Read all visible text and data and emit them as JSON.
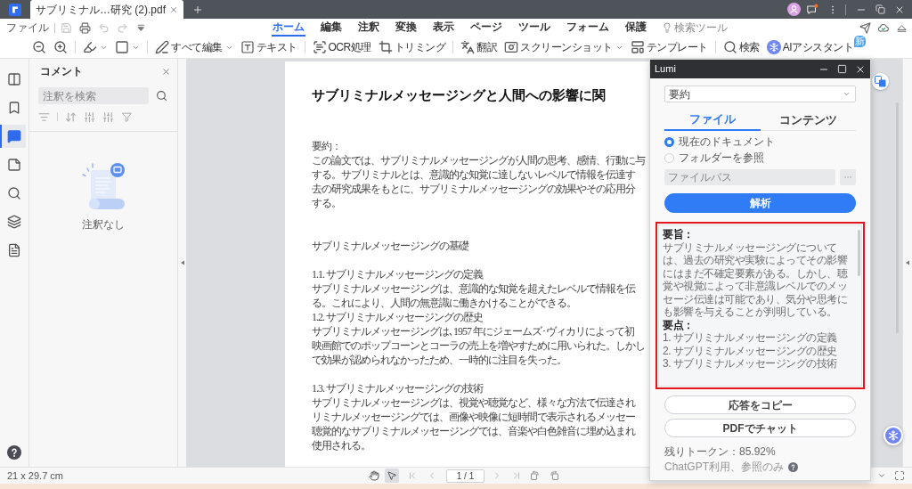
{
  "title_bar": {
    "document_tab": {
      "title": "サブリミナル…研究 (2).pdf"
    }
  },
  "menu_bar": {
    "file_menu": "ファイル",
    "quick_actions": [
      {
        "disabled": true
      },
      {
        "disabled": false
      },
      {
        "disabled": true
      },
      {
        "disabled": true
      }
    ],
    "tabs": [
      {
        "label": "ホーム",
        "selected": true
      },
      {
        "label": "編集",
        "selected": false
      },
      {
        "label": "注釈",
        "selected": false
      },
      {
        "label": "変換",
        "selected": false
      },
      {
        "label": "表示",
        "selected": false
      },
      {
        "label": "ページ",
        "selected": false
      },
      {
        "label": "ツール",
        "selected": false
      },
      {
        "label": "フォーム",
        "selected": false
      },
      {
        "label": "保護",
        "selected": false
      }
    ],
    "search_tools": {
      "label": "検索ツール",
      "disabled": true
    }
  },
  "toolbar": {
    "groups": [
      [
        {
          "dropdown": false
        },
        {
          "dropdown": false
        }
      ],
      [
        {
          "dropdown": true
        },
        {
          "dropdown": true
        }
      ],
      [
        {
          "label": "すべて編集",
          "dropdown": true
        },
        {
          "label": "テキスト",
          "dropdown": false
        }
      ],
      [
        {
          "label": "OCR処理",
          "dropdown": false
        },
        {
          "label": "トリミング",
          "dropdown": false
        }
      ],
      [
        {
          "label": "翻訳",
          "dropdown": false
        },
        {
          "label": "スクリーンショット",
          "dropdown": true
        },
        {
          "label": "テンプレート",
          "dropdown": false
        }
      ],
      [
        {
          "label": "検索",
          "dropdown": false
        },
        {
          "label": "AIアシスタント",
          "dropdown": false,
          "badge": "新"
        }
      ]
    ]
  },
  "side_rail": {
    "items": [
      {
        "selected": false
      },
      {
        "selected": false
      },
      {
        "selected": true
      },
      {
        "selected": false
      },
      {
        "selected": false
      },
      {
        "selected": false
      },
      {
        "selected": false
      }
    ]
  },
  "comments_panel": {
    "title": "コメント",
    "search": {
      "placeholder": "注釈を検索"
    },
    "empty_text": "注釈なし"
  },
  "document": {
    "title": "サブリミナルメッセージングと人間への影響に関",
    "groups": [
      [
        {
          "heading": "要約：",
          "lines": [
            "この論文では、サブリミナルメッセージングが人間の思考、感情、行動に与",
            "する。サブリミナルとは、意識的な知覚に達しないレベルで情報を伝達す",
            "去の研究成果をもとに、サブリミナルメッセージングの効果やその応用分",
            "する。"
          ]
        }
      ],
      [
        {
          "heading": "サブリミナルメッセージングの基礎"
        }
      ],
      [
        {
          "heading": "1.1. サブリミナルメッセージングの定義",
          "lines": [
            "サブリミナルメッセージングは、意識的な知覚を超えたレベルで情報を伝",
            "る。これにより、人間の無意識に働きかけることができる。"
          ]
        },
        {
          "heading": "1.2. サブリミナルメッセージングの歴史",
          "lines": [
            "サブリミナルメッセージングは､1957 年にジェームズ･ヴィカリによって初",
            "映画館でのポップコーンとコーラの売上を増やすために用いられた。しかし",
            "で効果が認められなかったため、一時的に注目を失った。"
          ]
        }
      ],
      [
        {
          "heading": "1.3. サブリミナルメッセージングの技術",
          "lines": [
            "サブリミナルメッセージングは、視覚や聴覚など、様々な方法で伝達され",
            "リミナルメッセージングでは、画像や映像に短時間で表示されるメッセー",
            "聴覚的なサブリミナルメッセージングでは、音楽や白色雑音に埋め込まれ",
            "使用される。"
          ]
        }
      ]
    ]
  },
  "status_bar": {
    "page_size": "21 x 29.7 cm",
    "tools": [
      {
        "selected": false
      },
      {
        "selected": true
      }
    ],
    "nav_buttons": [
      {
        "disabled": true
      },
      {
        "disabled": true
      },
      {
        "disabled": true
      },
      {
        "disabled": true
      }
    ],
    "page_field": {
      "value": "1 / 1"
    }
  },
  "lumi": {
    "title": "Lumi",
    "mode_select": {
      "value": "要約"
    },
    "tabs": [
      {
        "label": "ファイル",
        "selected": true
      },
      {
        "label": "コンテンツ",
        "selected": false
      }
    ],
    "sources": [
      {
        "label": "現在のドキュメント",
        "selected": true
      },
      {
        "label": "フォルダーを参照",
        "selected": false
      }
    ],
    "file_path": {
      "placeholder": "ファイルパス",
      "disabled": true
    },
    "analyze_button": "解析",
    "result": {
      "summary_heading": "要旨：",
      "summary": "サブリミナルメッセージングについては、過去の研究や実験によってその影響にはまだ不確定要素がある。しかし、聴覚や視覚によって非意識レベルでのメッセージ伝達は可能であり、気分や思考にも影響を与えることが判明している。",
      "points_heading": "要点：",
      "points": [
        "1. サブリミナルメッセージングの定義",
        "2. サブリミナルメッセージングの歴史",
        "3. サブリミナルメッセージングの技術"
      ]
    },
    "actions": [
      "応答をコピー",
      "PDFでチャット"
    ],
    "tokens": "残りトークン：85.92%",
    "note": "ChatGPT利用、参照のみ"
  }
}
